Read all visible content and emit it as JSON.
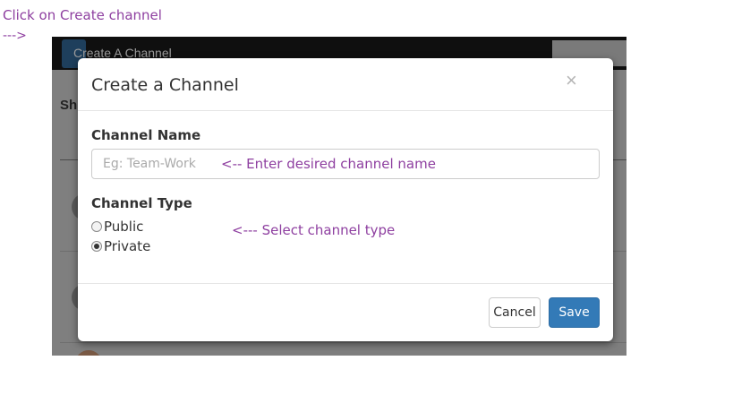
{
  "annotations": {
    "top_note": "Click on Create channel",
    "top_arrow": "--->",
    "name_hint": "<--  Enter desired channel name",
    "type_hint": "<--- Select channel type"
  },
  "background_app": {
    "create_button_label": "Create A Channel",
    "side_text": "Sh"
  },
  "modal": {
    "title": "Create a Channel",
    "close_glyph": "×",
    "channel_name_label": "Channel Name",
    "channel_name_placeholder": "Eg: Team-Work",
    "channel_name_value": "",
    "channel_type_label": "Channel Type",
    "options": [
      {
        "label": "Public",
        "checked": false
      },
      {
        "label": "Private",
        "checked": true
      }
    ],
    "cancel_label": "Cancel",
    "save_label": "Save"
  },
  "colors": {
    "annotation": "#8e3fa0",
    "primary": "#337ab7"
  }
}
